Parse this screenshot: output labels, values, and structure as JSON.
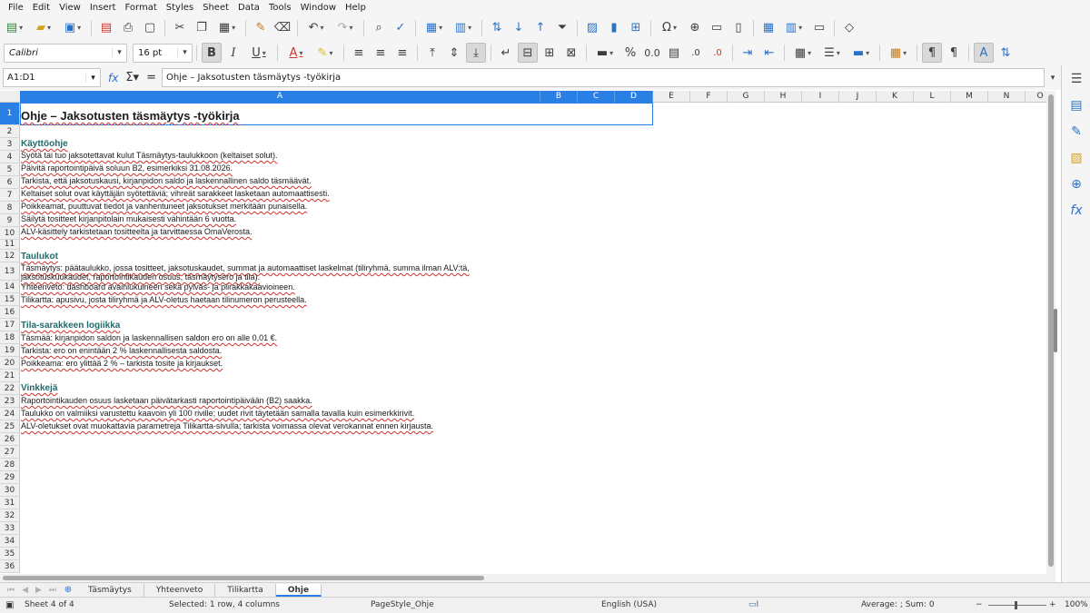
{
  "menu": [
    "File",
    "Edit",
    "View",
    "Insert",
    "Format",
    "Styles",
    "Sheet",
    "Data",
    "Tools",
    "Window",
    "Help"
  ],
  "font": {
    "name": "Calibri",
    "size": "16 pt"
  },
  "formula_bar": {
    "name_box": "A1:D1",
    "content": "Ohje – Jaksotusten täsmäytys -työkirja"
  },
  "columns": [
    "A",
    "B",
    "C",
    "D",
    "E",
    "F",
    "G",
    "H",
    "I",
    "J",
    "K",
    "L",
    "M",
    "N",
    "O"
  ],
  "rows": [
    "1",
    "2",
    "3",
    "4",
    "5",
    "6",
    "7",
    "8",
    "9",
    "10",
    "11",
    "12",
    "13",
    "14",
    "15",
    "16",
    "17",
    "18",
    "19",
    "20",
    "21",
    "22",
    "23",
    "24",
    "25",
    "26",
    "27",
    "28",
    "29",
    "30",
    "31",
    "32",
    "33",
    "34",
    "35",
    "36"
  ],
  "cells": {
    "r1": "Ohje – Jaksotusten täsmäytys -työkirja",
    "r3": "Käyttöohje",
    "r4": "Syötä tai tuo jaksotettavat kulut Täsmäytys-taulukkoon (keltaiset solut).",
    "r5": "Päivitä raportointipäivä soluun B2, esimerkiksi 31.08.2026.",
    "r6": "Tarkista, että jaksotuskausi, kirjanpidon saldo ja laskennallinen saldo täsmäävät.",
    "r7": "Keltaiset solut ovat käyttäjän syötettäviä; vihreät sarakkeet lasketaan automaattisesti.",
    "r8": "Poikkeamat, puuttuvat tiedot ja vanhentuneet jaksotukset merkitään punaisella.",
    "r9": "Säilytä tositteet kirjanpitolain mukaisesti vähintään 6 vuotta.",
    "r10": "ALV-käsittely tarkistetaan tositteelta ja tarvittaessa OmaVerosta.",
    "r12": "Taulukot",
    "r13a": "Täsmäytys: päätaulukko, jossa tositteet, jaksotuskaudet, summat ja automaattiset laskelmat (tiliryhmä, summa ilman ALV:tä,",
    "r13b": "jaksotuskuukaudet, raportointikauden osuus, täsmäytysero ja tila).",
    "r14": "Yhteenveto: dashboard avainlukuineen sekä pylväs- ja piirakkakaavioineen.",
    "r15": "Tilikartta: apusivu, josta tiliryhmä ja ALV-oletus haetaan tilinumeron perusteella.",
    "r17": "Tila-sarakkeen logiikka",
    "r18": "Täsmää: kirjanpidon saldon ja laskennallisen saldon ero on alle 0,01 €.",
    "r19": "Tarkista: ero on enintään 2 % laskennallisesta saldosta.",
    "r20": "Poikkeama: ero ylittää 2 % – tarkista tosite ja kirjaukset.",
    "r22": "Vinkkejä",
    "r23": "Raportointikauden osuus lasketaan päivätarkasti raportointipäivään (B2) saakka.",
    "r24": "Taulukko on valmiiksi varustettu kaavoin yli 100 riville; uudet rivit täytetään samalla tavalla kuin esimerkkirivit.",
    "r25": "ALV-oletukset ovat muokattavia parametreja Tilikartta-sivulla; tarkista voimassa olevat verokannat ennen kirjausta."
  },
  "sheet_tabs": [
    "Täsmäytys",
    "Yhteenveto",
    "Tilikartta",
    "Ohje"
  ],
  "active_tab": "Ohje",
  "status": {
    "sheet": "Sheet 4 of 4",
    "selection": "Selected: 1 row, 4 columns",
    "page_style": "PageStyle_Ohje",
    "language": "English (USA)",
    "summary": "Average: ; Sum: 0",
    "zoom": "100%"
  },
  "colors": {
    "accent": "#2a7fe4",
    "heading": "#1f6b6b",
    "spell": "#d2302d"
  }
}
